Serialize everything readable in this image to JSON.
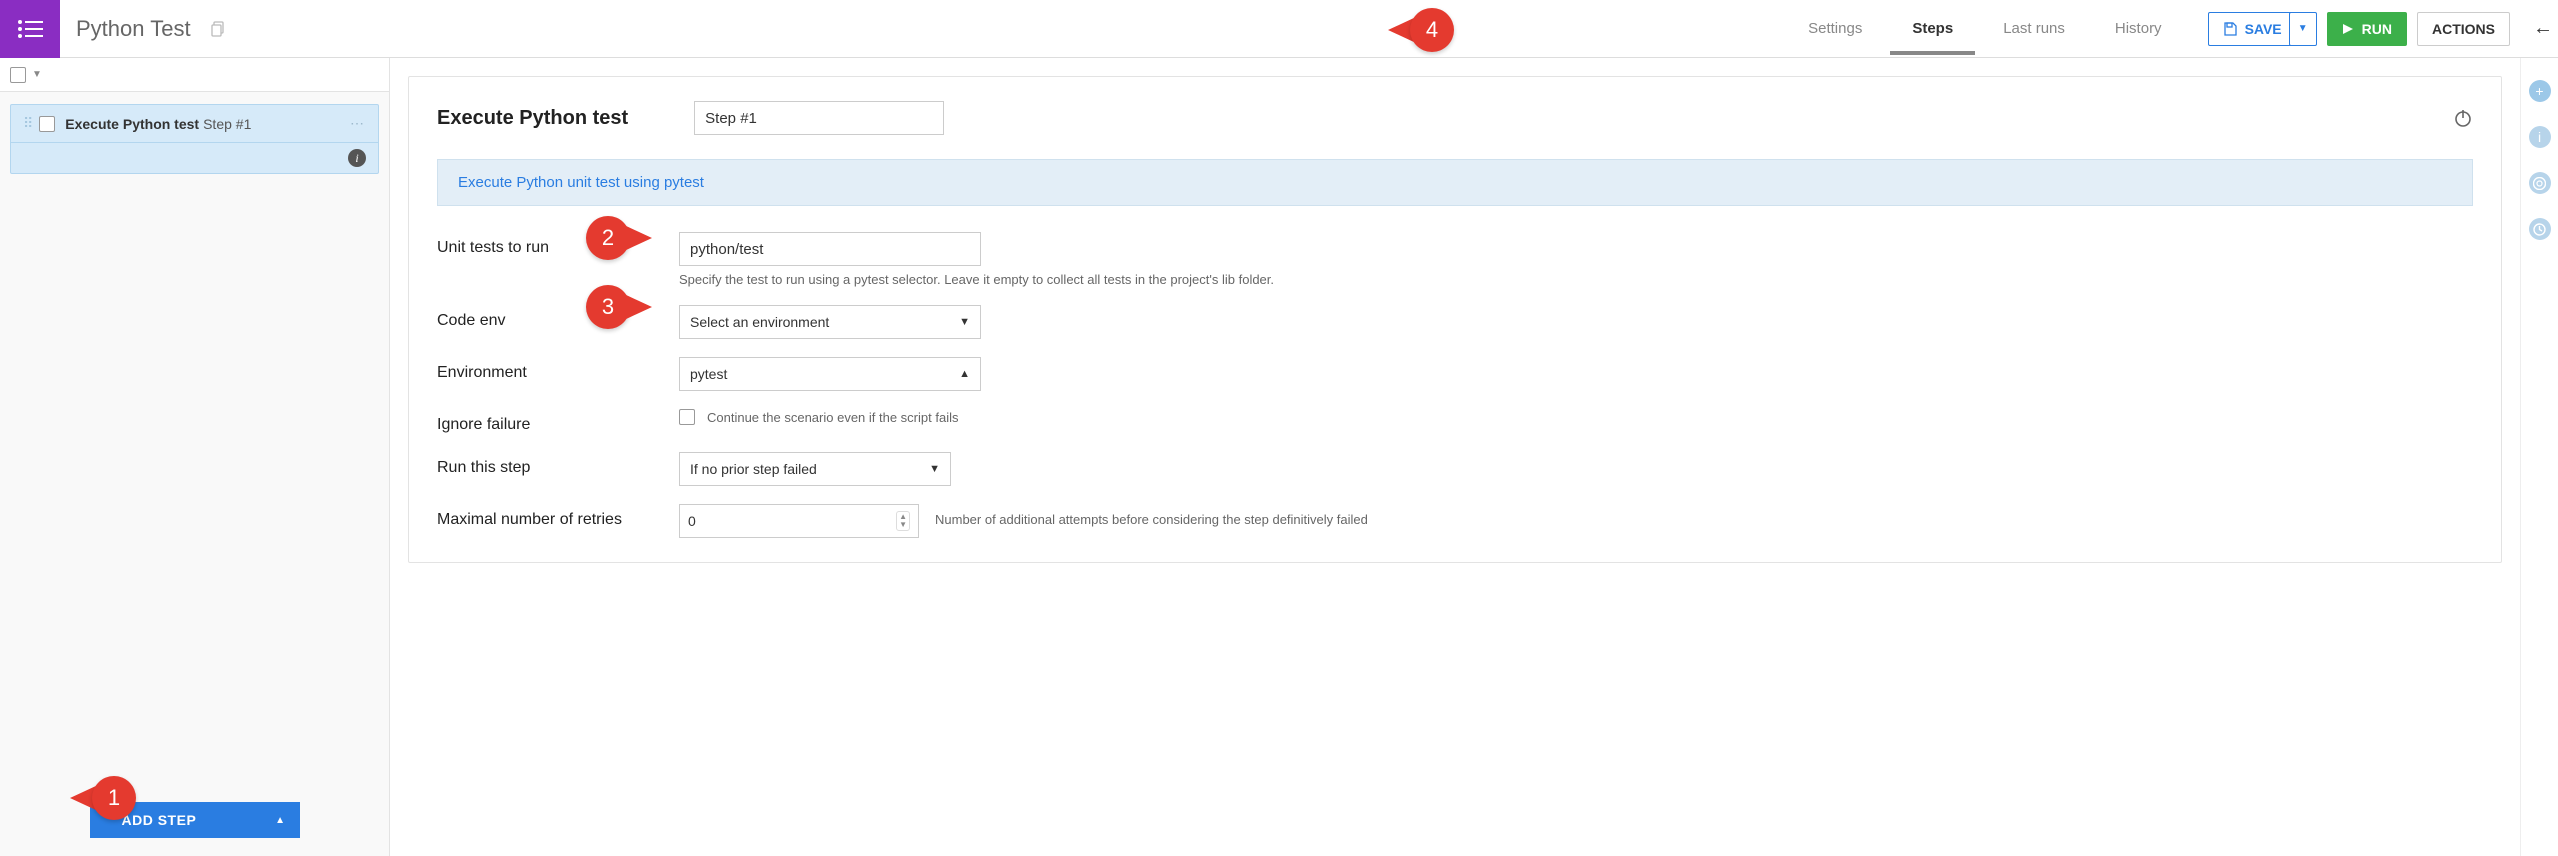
{
  "header": {
    "title": "Python Test",
    "tabs": [
      "Settings",
      "Steps",
      "Last runs",
      "History"
    ],
    "active_tab": 1,
    "save_label": "SAVE",
    "run_label": "RUN",
    "actions_label": "ACTIONS"
  },
  "sidebar": {
    "steps": [
      {
        "type_label": "Execute Python test",
        "name": "Step #1"
      }
    ],
    "add_step_label": "ADD STEP"
  },
  "panel": {
    "title": "Execute Python test",
    "name_input": "Step #1",
    "desc": "Execute Python unit test using pytest",
    "fields": {
      "unit_tests_label": "Unit tests to run",
      "unit_tests_value": "python/test",
      "unit_tests_help": "Specify the test to run using a pytest selector. Leave it empty to collect all tests in the project's lib folder.",
      "code_env_label": "Code env",
      "code_env_value": "Select an environment",
      "environment_label": "Environment",
      "environment_value": "pytest",
      "ignore_failure_label": "Ignore failure",
      "ignore_failure_check_label": "Continue the scenario even if the script fails",
      "run_this_step_label": "Run this step",
      "run_this_step_value": "If no prior step failed",
      "max_retries_label": "Maximal number of retries",
      "max_retries_value": "0",
      "max_retries_help": "Number of additional attempts before considering the step definitively failed"
    }
  },
  "callouts": {
    "c1": "1",
    "c2": "2",
    "c3": "3",
    "c4": "4"
  }
}
